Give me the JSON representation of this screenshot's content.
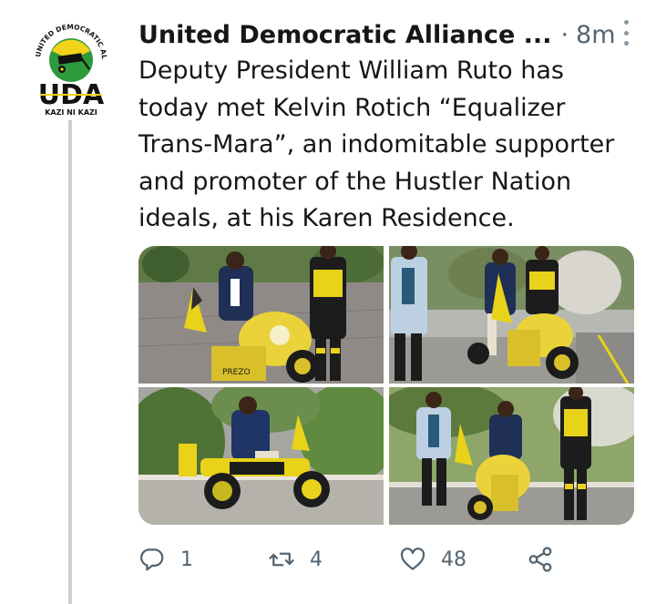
{
  "account": {
    "name": "United Democratic Alliance ...",
    "separator": "·",
    "time": "8m",
    "logo": {
      "arc_text": "UNITED DEMOCRATIC ALLIANCE",
      "wordmark": "UDA",
      "slogan": "KAZI NI KAZI",
      "colors": {
        "green": "#2e9a3b",
        "yellow": "#f2d21b",
        "black": "#111111"
      }
    }
  },
  "tweet": {
    "text": "Deputy President William Ruto has\ntoday met Kelvin Rotich “Equalizer\nTrans-Mara”, an indomitable supporter\nand promoter of the Hustler Nation\nideals, at his Karen Residence."
  },
  "media": {
    "photos": [
      {
        "alt": "photo-1",
        "plate_text": "PREZO"
      },
      {
        "alt": "photo-2",
        "plate_text": ""
      },
      {
        "alt": "photo-3",
        "plate_text": ""
      },
      {
        "alt": "photo-4",
        "plate_text": ""
      }
    ]
  },
  "actions": {
    "reply_count": "1",
    "retweet_count": "4",
    "like_count": "48",
    "icons": [
      "reply-icon",
      "retweet-icon",
      "like-icon",
      "share-icon"
    ]
  },
  "colors": {
    "muted": "#536471",
    "text": "#14171a",
    "thread_line": "#c9d0d6"
  }
}
